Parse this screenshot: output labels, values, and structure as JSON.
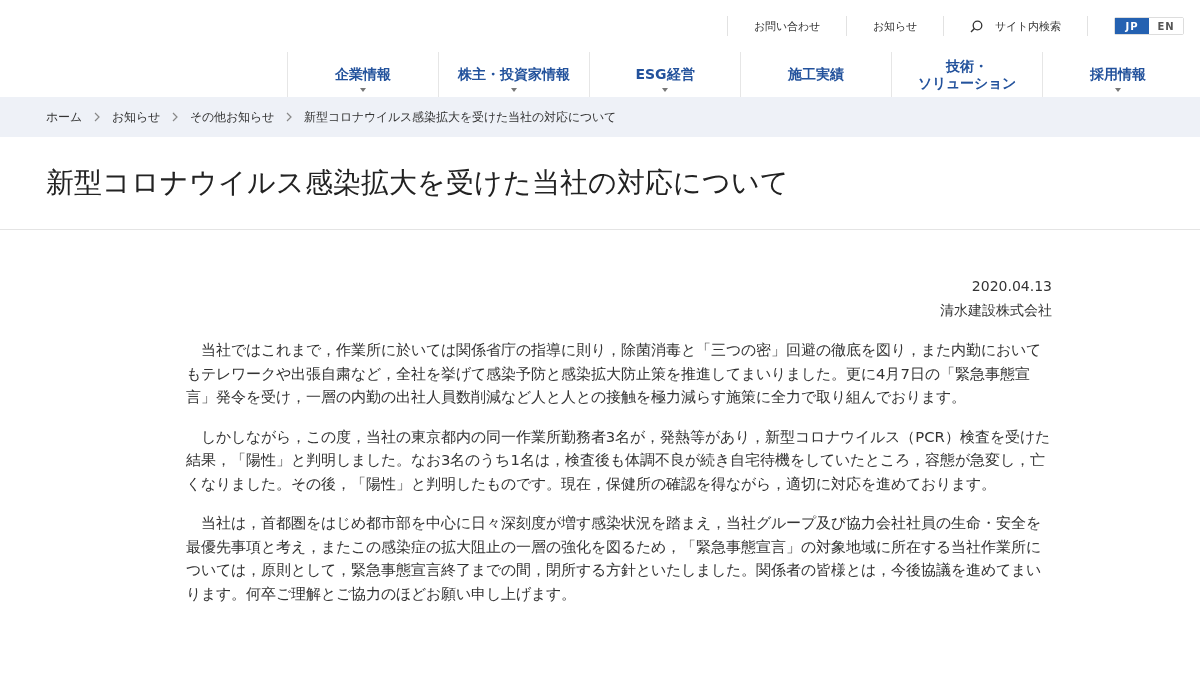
{
  "utility_links": [
    {
      "label": "お問い合わせ",
      "kind": "link"
    },
    {
      "label": "お知らせ",
      "kind": "link"
    },
    {
      "label": "サイト内検索",
      "kind": "search"
    }
  ],
  "languages": [
    {
      "label": "JP",
      "selected": true
    },
    {
      "label": "EN",
      "selected": false
    }
  ],
  "nav": [
    {
      "lines": [
        "企業情報"
      ],
      "has_menu": true
    },
    {
      "lines": [
        "株主・投資家情報"
      ],
      "has_menu": true
    },
    {
      "lines": [
        "ESG経営"
      ],
      "has_menu": true
    },
    {
      "lines": [
        "施工実績"
      ],
      "has_menu": false
    },
    {
      "lines": [
        "技術・",
        "ソリューション"
      ],
      "has_menu": false
    },
    {
      "lines": [
        "採用情報"
      ],
      "has_menu": true
    }
  ],
  "breadcrumb": [
    "ホーム",
    "お知らせ",
    "その他お知らせ",
    "新型コロナウイルス感染拡大を受けた当社の対応について"
  ],
  "title": "新型コロナウイルス感染拡大を受けた当社の対応について",
  "date": "2020.04.13",
  "company": "清水建設株式会社",
  "paragraphs": [
    "当社ではこれまで，作業所に於いては関係省庁の指導に則り，除菌消毒と「三つの密」回避の徹底を図り，また内勤においてもテレワークや出張自粛など，全社を挙げて感染予防と感染拡大防止策を推進してまいりました。更に4月7日の「緊急事態宣言」発令を受け，一層の内勤の出社人員数削減など人と人との接触を極力減らす施策に全力で取り組んでおります。",
    "しかしながら，この度，当社の東京都内の同一作業所勤務者3名が，発熱等があり，新型コロナウイルス（PCR）検査を受けた結果，「陽性」と判明しました。なお3名のうち1名は，検査後も体調不良が続き自宅待機をしていたところ，容態が急変し，亡くなりました。その後，「陽性」と判明したものです。現在，保健所の確認を得ながら，適切に対応を進めております。",
    "当社は，首都圏をはじめ都市部を中心に日々深刻度が増す感染状況を踏まえ，当社グループ及び協力会社社員の生命・安全を最優先事項と考え，またこの感染症の拡大阻止の一層の強化を図るため，「緊急事態宣言」の対象地域に所在する当社作業所については，原則として，緊急事態宣言終了までの間，閉所する方針といたしました。関係者の皆様とは，今後協議を進めてまいります。何卒ご理解とご協力のほどお願い申し上げます。"
  ]
}
